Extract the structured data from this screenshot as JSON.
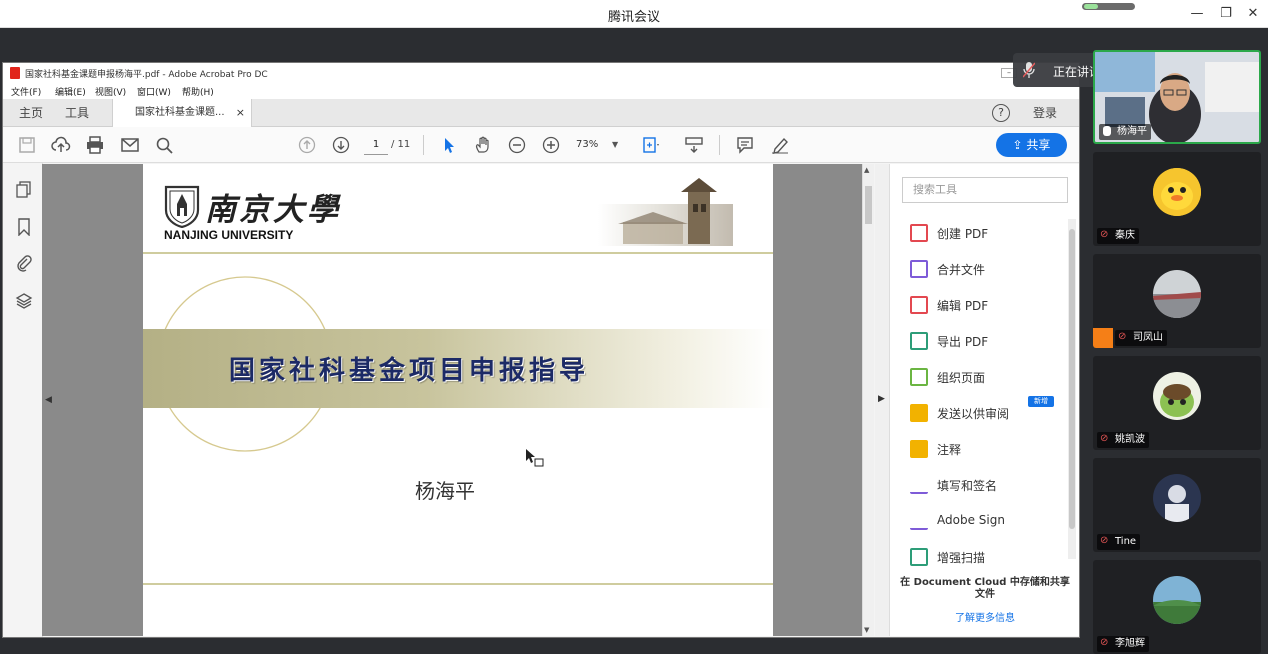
{
  "meeting": {
    "app_title": "腾讯会议",
    "speaking_label": "正在讲话: 杨海平;"
  },
  "acrobat": {
    "window_title": "国家社科基金课题申报杨海平.pdf - Adobe Acrobat Pro DC",
    "menu": [
      "文件(F)",
      "编辑(E)",
      "视图(V)",
      "窗口(W)",
      "帮助(H)"
    ],
    "tabs": {
      "home": "主页",
      "tools": "工具",
      "doc": "国家社科基金课题...",
      "close": "×"
    },
    "help": "?",
    "login": "登录",
    "page_current": "1",
    "page_total": "/ 11",
    "zoom": "73%",
    "share": "共享",
    "search_placeholder": "搜索工具",
    "tools": [
      {
        "label": "创建 PDF",
        "color": "#e34850"
      },
      {
        "label": "合并文件",
        "color": "#7e5bd8"
      },
      {
        "label": "编辑 PDF",
        "color": "#e34850"
      },
      {
        "label": "导出 PDF",
        "color": "#2d9d78"
      },
      {
        "label": "组织页面",
        "color": "#6bb542"
      },
      {
        "label": "发送以供审阅",
        "color": "#f2b200"
      },
      {
        "label": "注释",
        "color": "#f2b200"
      },
      {
        "label": "填写和签名",
        "color": "#7e5bd8"
      },
      {
        "label": "Adobe Sign",
        "color": "#7e5bd8"
      },
      {
        "label": "增强扫描",
        "color": "#2d9d78"
      }
    ],
    "new_badge": "新增",
    "cloud_text": "在 Document Cloud 中存储和共享文件",
    "learn_more": "了解更多信息"
  },
  "slide": {
    "university_cn": "南京大學",
    "university_en": "NANJING UNIVERSITY",
    "title": "国家社科基金项目申报指导",
    "presenter": "杨海平"
  },
  "participants": [
    {
      "name": "杨海平",
      "type": "video"
    },
    {
      "name": "秦庆",
      "type": "avatar"
    },
    {
      "name": "司凤山",
      "type": "avatar"
    },
    {
      "name": "姚凯波",
      "type": "avatar"
    },
    {
      "name": "Tine",
      "type": "avatar"
    },
    {
      "name": "李旭辉",
      "type": "avatar"
    }
  ],
  "colors": {
    "accent": "#1473e6",
    "active_speaker": "#2ba84a",
    "slide_band": "#b9b68a",
    "slide_title": "#1c2a66"
  }
}
